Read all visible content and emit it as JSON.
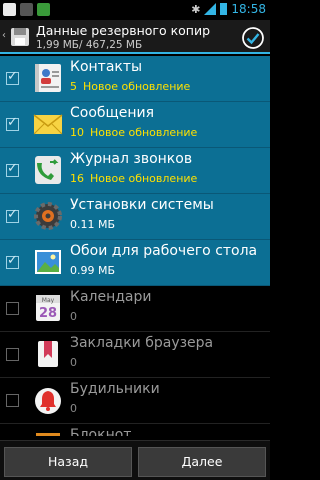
{
  "status": {
    "time": "18:58"
  },
  "title": {
    "text": "Данные резервного копир",
    "subtitle": "1,99 МБ/ 467,25 МБ"
  },
  "items": [
    {
      "name": "Контакты",
      "count": "5",
      "status": "Новое обновление",
      "checked": true,
      "icon": "contacts-icon"
    },
    {
      "name": "Сообщения",
      "count": "10",
      "status": "Новое обновление",
      "checked": true,
      "icon": "messages-icon"
    },
    {
      "name": "Журнал звонков",
      "count": "16",
      "status": "Новое обновление",
      "checked": true,
      "icon": "call-log-icon"
    },
    {
      "name": "Установки системы",
      "count": "0.11",
      "status": "МБ",
      "checked": true,
      "icon": "settings-icon"
    },
    {
      "name": "Обои для рабочего стола",
      "count": "0.99",
      "status": "МБ",
      "checked": true,
      "icon": "wallpaper-icon"
    },
    {
      "name": "Календари",
      "count": "0",
      "status": "",
      "checked": false,
      "icon": "calendar-icon"
    },
    {
      "name": "Закладки браузера",
      "count": "0",
      "status": "",
      "checked": false,
      "icon": "bookmark-icon"
    },
    {
      "name": "Будильники",
      "count": "0",
      "status": "",
      "checked": false,
      "icon": "alarm-icon"
    },
    {
      "name": "Блокнот",
      "count": "",
      "status": "",
      "checked": false,
      "icon": "notepad-icon"
    }
  ],
  "calendar_icon": {
    "month": "May",
    "day": "28"
  },
  "buttons": {
    "back": "Назад",
    "next": "Далее"
  },
  "colors": {
    "accent": "#33b5e5",
    "selected_row": "#0c6f94",
    "highlight": "#ffe100"
  }
}
